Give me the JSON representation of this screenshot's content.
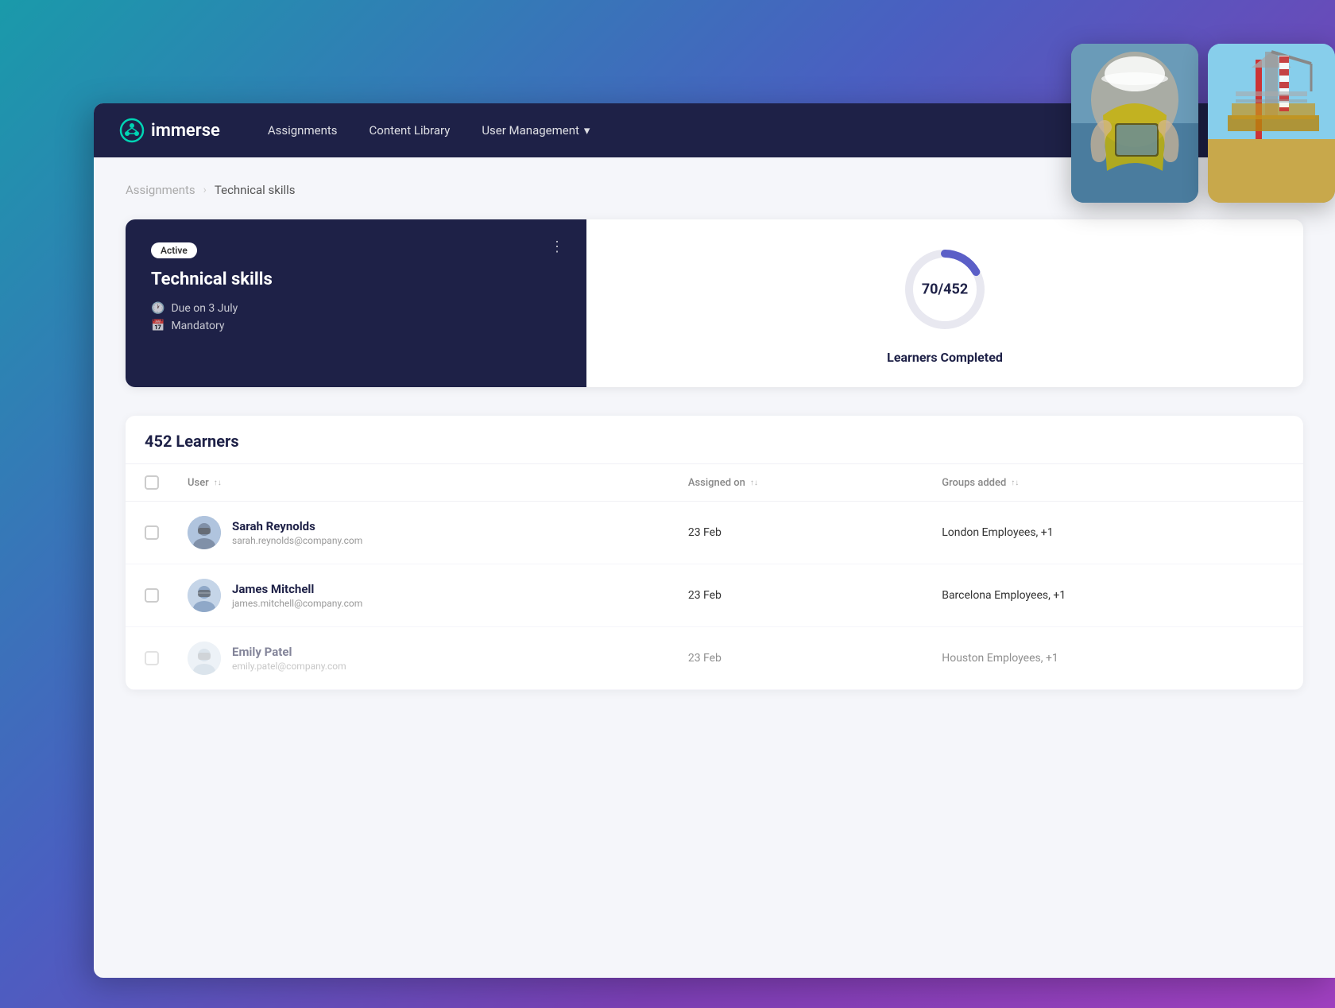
{
  "app": {
    "logo_text": "immerse"
  },
  "nav": {
    "links": [
      {
        "id": "assignments",
        "label": "Assignments",
        "has_dropdown": false
      },
      {
        "id": "content-library",
        "label": "Content Library",
        "has_dropdown": false
      },
      {
        "id": "user-management",
        "label": "User Management",
        "has_dropdown": true
      }
    ]
  },
  "breadcrumb": {
    "parent": "Assignments",
    "separator": "›",
    "current": "Technical skills"
  },
  "assignment_card": {
    "badge": "Active",
    "title": "Technical skills",
    "due_label": "Due on 3 July",
    "mandatory_label": "Mandatory",
    "more_icon": "⋮"
  },
  "learners_completed": {
    "completed": 70,
    "total": 452,
    "display": "70/452",
    "label": "Learners Completed"
  },
  "learners_section": {
    "count_label": "452 Learners",
    "columns": {
      "user": "User",
      "assigned_on": "Assigned on",
      "groups_added": "Groups added"
    },
    "rows": [
      {
        "id": 1,
        "name": "Sarah Reynolds",
        "email": "sarah.reynolds@company.com",
        "assigned_on": "23 Feb",
        "groups": "London Employees, +1",
        "faded": false
      },
      {
        "id": 2,
        "name": "James Mitchell",
        "email": "james.mitchell@company.com",
        "assigned_on": "23 Feb",
        "groups": "Barcelona Employees, +1",
        "faded": false
      },
      {
        "id": 3,
        "name": "Emily Patel",
        "email": "emily.patel@company.com",
        "assigned_on": "23 Feb",
        "groups": "Houston Employees, +1",
        "faded": true
      }
    ]
  },
  "colors": {
    "nav_bg": "#1e2147",
    "card_bg": "#1e2147",
    "accent": "#5b5fc7",
    "white": "#ffffff"
  }
}
